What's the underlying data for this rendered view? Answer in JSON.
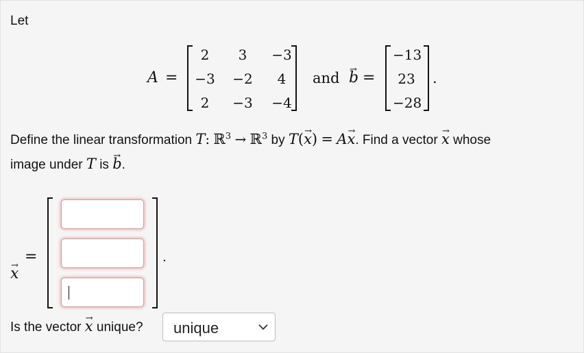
{
  "intro": "Let",
  "matrix_A": {
    "label": "A",
    "eq": "=",
    "rows": [
      [
        "2",
        "3",
        "−3"
      ],
      [
        "−3",
        "−2",
        "4"
      ],
      [
        "2",
        "−3",
        "−4"
      ]
    ]
  },
  "and_text": "and",
  "vector_b": {
    "label": "b",
    "eq": "=",
    "entries": [
      "−13",
      "23",
      "−28"
    ],
    "period": "."
  },
  "definition": {
    "text1": "Define the linear transformation",
    "T": "T",
    "colon": ":",
    "R": "ℝ",
    "exp": "3",
    "arrow": "→",
    "text2": "by",
    "paren_open": "(",
    "paren_close": ")",
    "eq": "=",
    "A": "A",
    "text3": ". Find a vector",
    "text4": "whose",
    "line2a": "image under",
    "line2b": "is",
    "period": "."
  },
  "vector_x": {
    "label": "x",
    "eq": "=",
    "inputs": [
      "",
      "",
      ""
    ],
    "period": "."
  },
  "unique_question": {
    "text1": "Is the vector",
    "text2": "unique?",
    "selected": "unique"
  }
}
